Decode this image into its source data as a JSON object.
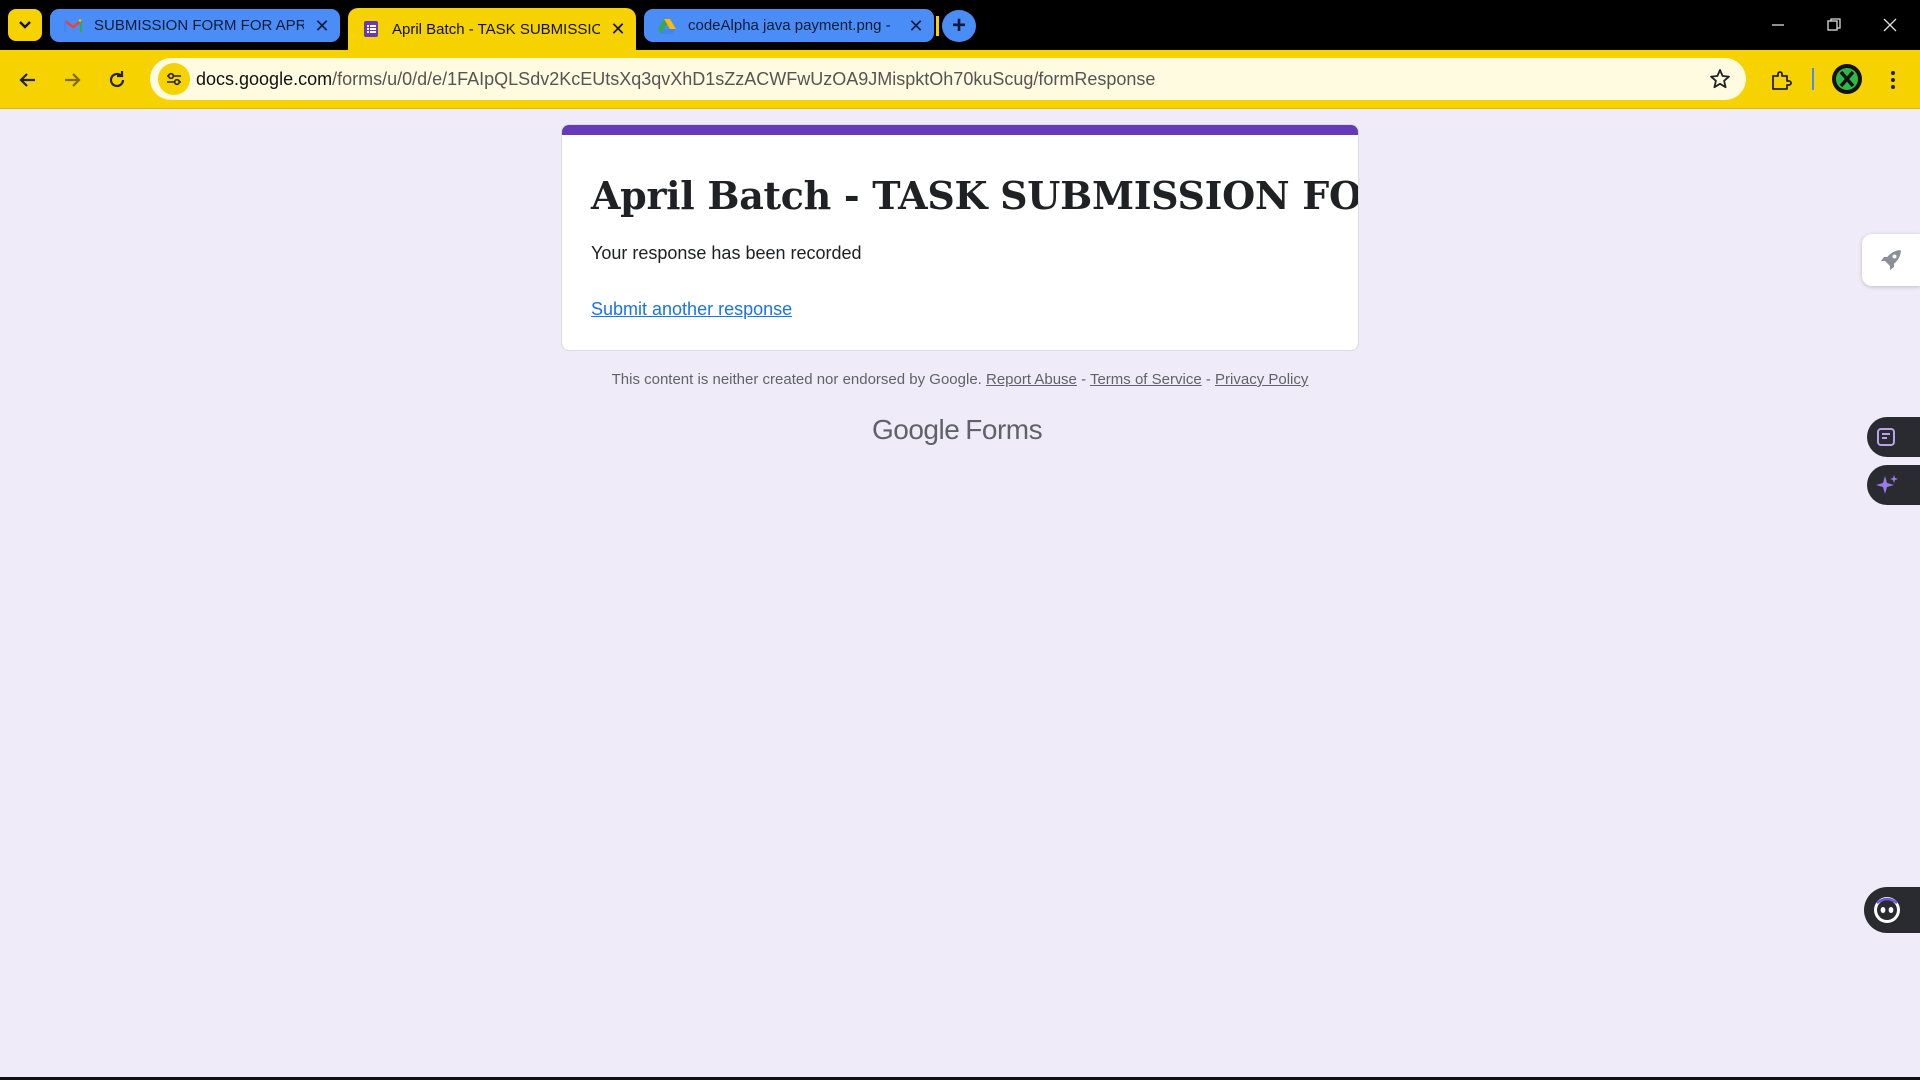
{
  "browser": {
    "tabs": [
      {
        "title": "SUBMISSION FORM FOR APRIL",
        "icon": "gmail-icon",
        "active": false
      },
      {
        "title": "April Batch - TASK SUBMISSION",
        "icon": "google-forms-icon",
        "active": true
      },
      {
        "title": "codeAlpha java payment.png -",
        "icon": "google-drive-icon",
        "active": false
      }
    ],
    "new_tab_label": "+",
    "url_host": "docs.google.com",
    "url_path": "/forms/u/0/d/e/1FAIpQLSdv2KcEUtsXq3qvXhD1sZzACWFwUzOA9JMispktOh70kuScug/formResponse",
    "window_controls": [
      "minimize",
      "restore",
      "close"
    ]
  },
  "form": {
    "title": "April Batch - TASK SUBMISSION FORM",
    "confirmation": "Your response has been recorded",
    "submit_another": "Submit another response",
    "accent_color": "#673ab7"
  },
  "footer": {
    "disclaimer": "This content is neither created nor endorsed by Google.",
    "report_abuse": "Report Abuse",
    "terms": "Terms of Service",
    "privacy": "Privacy Policy",
    "sep": " - ",
    "brand_google": "Google",
    "brand_forms": "Forms"
  },
  "colors": {
    "browser_theme": "#f5d200",
    "tab_inactive": "#4b8df6",
    "page_bg": "#f0ebf8",
    "link": "#1a73e8"
  }
}
